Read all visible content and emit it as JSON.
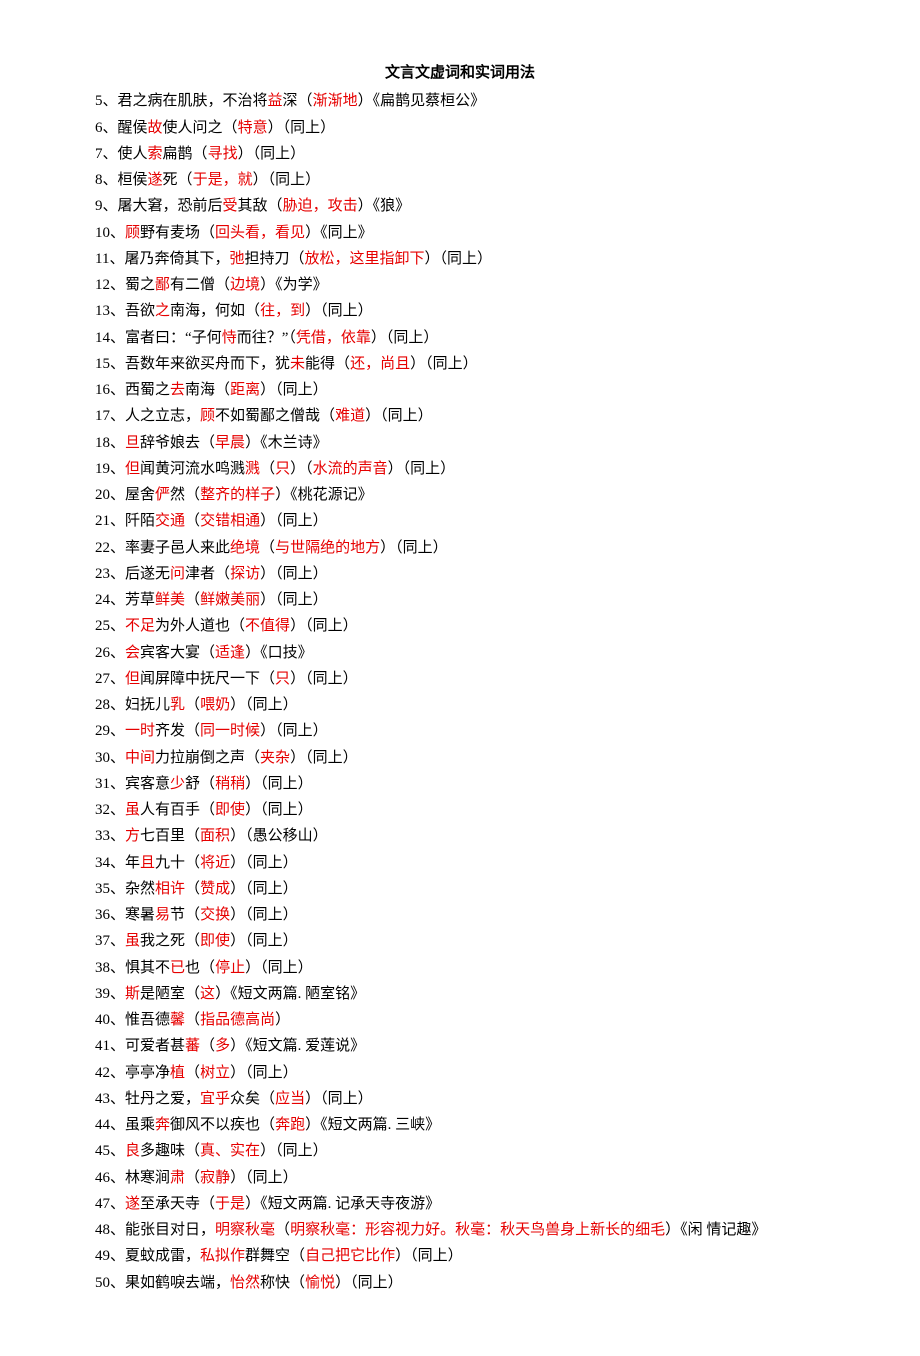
{
  "title": "文言文虚词和实词用法",
  "entries": [
    {
      "n": "5",
      "segs": [
        [
          "b",
          "君之病在肌肤，不治将"
        ],
        [
          "r",
          "益"
        ],
        [
          "b",
          "深（"
        ],
        [
          "r",
          "渐渐地"
        ],
        [
          "b",
          "）《扁鹊见蔡桓公》"
        ]
      ]
    },
    {
      "n": "6",
      "segs": [
        [
          "b",
          "醒侯"
        ],
        [
          "r",
          "故"
        ],
        [
          "b",
          "使人问之（"
        ],
        [
          "r",
          "特意"
        ],
        [
          "b",
          "）（同上）"
        ]
      ]
    },
    {
      "n": "7",
      "segs": [
        [
          "b",
          "使人"
        ],
        [
          "r",
          "索"
        ],
        [
          "b",
          "扁鹊（"
        ],
        [
          "r",
          "寻找"
        ],
        [
          "b",
          "）（同上）"
        ]
      ]
    },
    {
      "n": "8",
      "segs": [
        [
          "b",
          "桓侯"
        ],
        [
          "r",
          "遂"
        ],
        [
          "b",
          "死（"
        ],
        [
          "r",
          "于是，就"
        ],
        [
          "b",
          "）（同上）"
        ]
      ]
    },
    {
      "n": "9",
      "segs": [
        [
          "b",
          "屠大窘，恐前后"
        ],
        [
          "r",
          "受"
        ],
        [
          "b",
          "其敌（"
        ],
        [
          "r",
          "胁迫，攻击"
        ],
        [
          "b",
          "）《狼》"
        ]
      ]
    },
    {
      "n": "10",
      "segs": [
        [
          "r",
          "顾"
        ],
        [
          "b",
          "野有麦场（"
        ],
        [
          "r",
          "回头看，看见"
        ],
        [
          "b",
          "）《同上》"
        ]
      ]
    },
    {
      "n": "11",
      "segs": [
        [
          "b",
          "屠乃奔倚其下，"
        ],
        [
          "r",
          "弛"
        ],
        [
          "b",
          "担持刀（"
        ],
        [
          "r",
          "放松，这里指卸下"
        ],
        [
          "b",
          "）（同上）"
        ]
      ]
    },
    {
      "n": "12",
      "segs": [
        [
          "b",
          "蜀之"
        ],
        [
          "r",
          "鄙"
        ],
        [
          "b",
          "有二僧（"
        ],
        [
          "r",
          "边境"
        ],
        [
          "b",
          "）《为学》"
        ]
      ]
    },
    {
      "n": "13",
      "segs": [
        [
          "b",
          "吾欲"
        ],
        [
          "r",
          "之"
        ],
        [
          "b",
          "南海，何如（"
        ],
        [
          "r",
          "往，到"
        ],
        [
          "b",
          "）（同上）"
        ]
      ]
    },
    {
      "n": "14",
      "segs": [
        [
          "b",
          "富者曰：“子何"
        ],
        [
          "r",
          "恃"
        ],
        [
          "b",
          "而往？”（"
        ],
        [
          "r",
          "凭借，依靠"
        ],
        [
          "b",
          "）（同上）"
        ]
      ]
    },
    {
      "n": "15",
      "segs": [
        [
          "b",
          "吾数年来欲买舟而下，犹"
        ],
        [
          "r",
          "未"
        ],
        [
          "b",
          "能得（"
        ],
        [
          "r",
          "还，尚且"
        ],
        [
          "b",
          "）（同上）"
        ]
      ]
    },
    {
      "n": "16",
      "segs": [
        [
          "b",
          "西蜀之"
        ],
        [
          "r",
          "去"
        ],
        [
          "b",
          "南海（"
        ],
        [
          "r",
          "距离"
        ],
        [
          "b",
          "）（同上）"
        ]
      ]
    },
    {
      "n": "17",
      "segs": [
        [
          "b",
          "人之立志，"
        ],
        [
          "r",
          "顾"
        ],
        [
          "b",
          "不如蜀鄙之僧哉（"
        ],
        [
          "r",
          "难道"
        ],
        [
          "b",
          "）（同上）"
        ]
      ]
    },
    {
      "n": "18",
      "segs": [
        [
          "r",
          "旦"
        ],
        [
          "b",
          "辞爷娘去（"
        ],
        [
          "r",
          "早晨"
        ],
        [
          "b",
          "）《木兰诗》"
        ]
      ]
    },
    {
      "n": "19",
      "segs": [
        [
          "r",
          "但"
        ],
        [
          "b",
          "闻黄河流水鸣溅"
        ],
        [
          "r",
          "溅"
        ],
        [
          "b",
          "（"
        ],
        [
          "r",
          "只"
        ],
        [
          "b",
          "）（"
        ],
        [
          "r",
          "水流的声音"
        ],
        [
          "b",
          "）（同上）"
        ]
      ]
    },
    {
      "n": "20",
      "segs": [
        [
          "b",
          "屋舍"
        ],
        [
          "r",
          "俨"
        ],
        [
          "b",
          "然（"
        ],
        [
          "r",
          "整齐的样子"
        ],
        [
          "b",
          "）《桃花源记》"
        ]
      ]
    },
    {
      "n": "21",
      "segs": [
        [
          "b",
          "阡陌"
        ],
        [
          "r",
          "交通"
        ],
        [
          "b",
          "（"
        ],
        [
          "r",
          "交错相通"
        ],
        [
          "b",
          "）（同上）"
        ]
      ]
    },
    {
      "n": "22",
      "segs": [
        [
          "b",
          "率妻子邑人来此"
        ],
        [
          "r",
          "绝境"
        ],
        [
          "b",
          "（"
        ],
        [
          "r",
          "与世隔绝的地方"
        ],
        [
          "b",
          "）（同上）"
        ]
      ]
    },
    {
      "n": "23",
      "segs": [
        [
          "b",
          "后遂无"
        ],
        [
          "r",
          "问"
        ],
        [
          "b",
          "津者（"
        ],
        [
          "r",
          "探访"
        ],
        [
          "b",
          "）（同上）"
        ]
      ]
    },
    {
      "n": "24",
      "segs": [
        [
          "b",
          "芳草"
        ],
        [
          "r",
          "鲜美"
        ],
        [
          "b",
          "（"
        ],
        [
          "r",
          "鲜嫩美丽"
        ],
        [
          "b",
          "）（同上）"
        ]
      ]
    },
    {
      "n": "25",
      "segs": [
        [
          "r",
          "不足"
        ],
        [
          "b",
          "为外人道也（"
        ],
        [
          "r",
          "不值得"
        ],
        [
          "b",
          "）（同上）"
        ]
      ]
    },
    {
      "n": "26",
      "segs": [
        [
          "r",
          "会"
        ],
        [
          "b",
          "宾客大宴（"
        ],
        [
          "r",
          "适逢"
        ],
        [
          "b",
          "）《口技》"
        ]
      ]
    },
    {
      "n": "27",
      "segs": [
        [
          "r",
          "但"
        ],
        [
          "b",
          "闻屏障中抚尺一下（"
        ],
        [
          "r",
          "只"
        ],
        [
          "b",
          "）（同上）"
        ]
      ]
    },
    {
      "n": "28",
      "segs": [
        [
          "b",
          "妇抚儿"
        ],
        [
          "r",
          "乳"
        ],
        [
          "b",
          "（"
        ],
        [
          "r",
          "喂奶"
        ],
        [
          "b",
          "）（同上）"
        ]
      ]
    },
    {
      "n": "29",
      "segs": [
        [
          "r",
          "一时"
        ],
        [
          "b",
          "齐发（"
        ],
        [
          "r",
          "同一时候"
        ],
        [
          "b",
          "）（同上）"
        ]
      ]
    },
    {
      "n": "30",
      "segs": [
        [
          "r",
          "中间"
        ],
        [
          "b",
          "力拉崩倒之声（"
        ],
        [
          "r",
          "夹杂"
        ],
        [
          "b",
          "）（同上）"
        ]
      ]
    },
    {
      "n": "31",
      "segs": [
        [
          "b",
          "宾客意"
        ],
        [
          "r",
          "少"
        ],
        [
          "b",
          "舒（"
        ],
        [
          "r",
          "稍稍"
        ],
        [
          "b",
          "）（同上）"
        ]
      ]
    },
    {
      "n": "32",
      "segs": [
        [
          "r",
          "虽"
        ],
        [
          "b",
          "人有百手（"
        ],
        [
          "r",
          "即使"
        ],
        [
          "b",
          "）（同上）"
        ]
      ]
    },
    {
      "n": "33",
      "segs": [
        [
          "r",
          "方"
        ],
        [
          "b",
          "七百里（"
        ],
        [
          "r",
          "面积"
        ],
        [
          "b",
          "）（愚公移山）"
        ]
      ]
    },
    {
      "n": "34",
      "segs": [
        [
          "b",
          "年"
        ],
        [
          "r",
          "且"
        ],
        [
          "b",
          "九十（"
        ],
        [
          "r",
          "将近"
        ],
        [
          "b",
          "）（同上）"
        ]
      ]
    },
    {
      "n": "35",
      "segs": [
        [
          "b",
          "杂然"
        ],
        [
          "r",
          "相许"
        ],
        [
          "b",
          "（"
        ],
        [
          "r",
          "赞成"
        ],
        [
          "b",
          "）（同上）"
        ]
      ]
    },
    {
      "n": "36",
      "segs": [
        [
          "b",
          "寒暑"
        ],
        [
          "r",
          "易"
        ],
        [
          "b",
          "节（"
        ],
        [
          "r",
          "交换"
        ],
        [
          "b",
          "）（同上）"
        ]
      ]
    },
    {
      "n": "37",
      "segs": [
        [
          "r",
          "虽"
        ],
        [
          "b",
          "我之死（"
        ],
        [
          "r",
          "即使"
        ],
        [
          "b",
          "）（同上）"
        ]
      ]
    },
    {
      "n": "38",
      "segs": [
        [
          "b",
          "惧其不"
        ],
        [
          "r",
          "已"
        ],
        [
          "b",
          "也（"
        ],
        [
          "r",
          "停止"
        ],
        [
          "b",
          "）（同上）"
        ]
      ]
    },
    {
      "n": "39",
      "segs": [
        [
          "r",
          "斯"
        ],
        [
          "b",
          "是陋室（"
        ],
        [
          "r",
          "这"
        ],
        [
          "b",
          "）《短文两篇. 陋室铭》"
        ]
      ]
    },
    {
      "n": "40",
      "segs": [
        [
          "b",
          "惟吾德"
        ],
        [
          "r",
          "馨"
        ],
        [
          "b",
          "（"
        ],
        [
          "r",
          "指品德高尚"
        ],
        [
          "b",
          "）"
        ]
      ]
    },
    {
      "n": "41",
      "segs": [
        [
          "b",
          "可爱者甚"
        ],
        [
          "r",
          "蕃"
        ],
        [
          "b",
          "（"
        ],
        [
          "r",
          "多"
        ],
        [
          "b",
          "）《短文篇. 爱莲说》"
        ]
      ]
    },
    {
      "n": "42",
      "segs": [
        [
          "b",
          "亭亭净"
        ],
        [
          "r",
          "植"
        ],
        [
          "b",
          "（"
        ],
        [
          "r",
          "树立"
        ],
        [
          "b",
          "）（同上）"
        ]
      ]
    },
    {
      "n": "43",
      "segs": [
        [
          "b",
          "牡丹之爱，"
        ],
        [
          "r",
          "宜乎"
        ],
        [
          "b",
          "众矣（"
        ],
        [
          "r",
          "应当"
        ],
        [
          "b",
          "）（同上）"
        ]
      ]
    },
    {
      "n": "44",
      "segs": [
        [
          "b",
          "虽乘"
        ],
        [
          "r",
          "奔"
        ],
        [
          "b",
          "御风不以疾也（"
        ],
        [
          "r",
          "奔跑"
        ],
        [
          "b",
          "）《短文两篇. 三峡》"
        ]
      ]
    },
    {
      "n": "45",
      "segs": [
        [
          "r",
          "良"
        ],
        [
          "b",
          "多趣味（"
        ],
        [
          "r",
          "真、实在"
        ],
        [
          "b",
          "）（同上）"
        ]
      ]
    },
    {
      "n": "46",
      "segs": [
        [
          "b",
          "林寒涧"
        ],
        [
          "r",
          "肃"
        ],
        [
          "b",
          "（"
        ],
        [
          "r",
          "寂静"
        ],
        [
          "b",
          "）（同上）"
        ]
      ]
    },
    {
      "n": "47",
      "segs": [
        [
          "r",
          "遂"
        ],
        [
          "b",
          "至承天寺（"
        ],
        [
          "r",
          "于是"
        ],
        [
          "b",
          "）《短文两篇. 记承天寺夜游》"
        ]
      ]
    },
    {
      "n": "48",
      "segs": [
        [
          "b",
          "能张目对日，"
        ],
        [
          "r",
          "明察秋毫"
        ],
        [
          "b",
          "（"
        ],
        [
          "r",
          "明察秋毫：形容视力好。秋毫：秋天鸟兽身上新长的细毛"
        ],
        [
          "b",
          "）《闲  情记趣》"
        ]
      ]
    },
    {
      "n": "49",
      "segs": [
        [
          "b",
          "夏蚊成雷，"
        ],
        [
          "r",
          "私拟作"
        ],
        [
          "b",
          "群舞空（"
        ],
        [
          "r",
          "自己把它比作"
        ],
        [
          "b",
          "）（同上）"
        ]
      ]
    },
    {
      "n": "50",
      "segs": [
        [
          "b",
          "果如鹤唳去端，"
        ],
        [
          "r",
          "怡然"
        ],
        [
          "b",
          "称快（"
        ],
        [
          "r",
          "愉悦"
        ],
        [
          "b",
          "）（同上）"
        ]
      ]
    }
  ]
}
